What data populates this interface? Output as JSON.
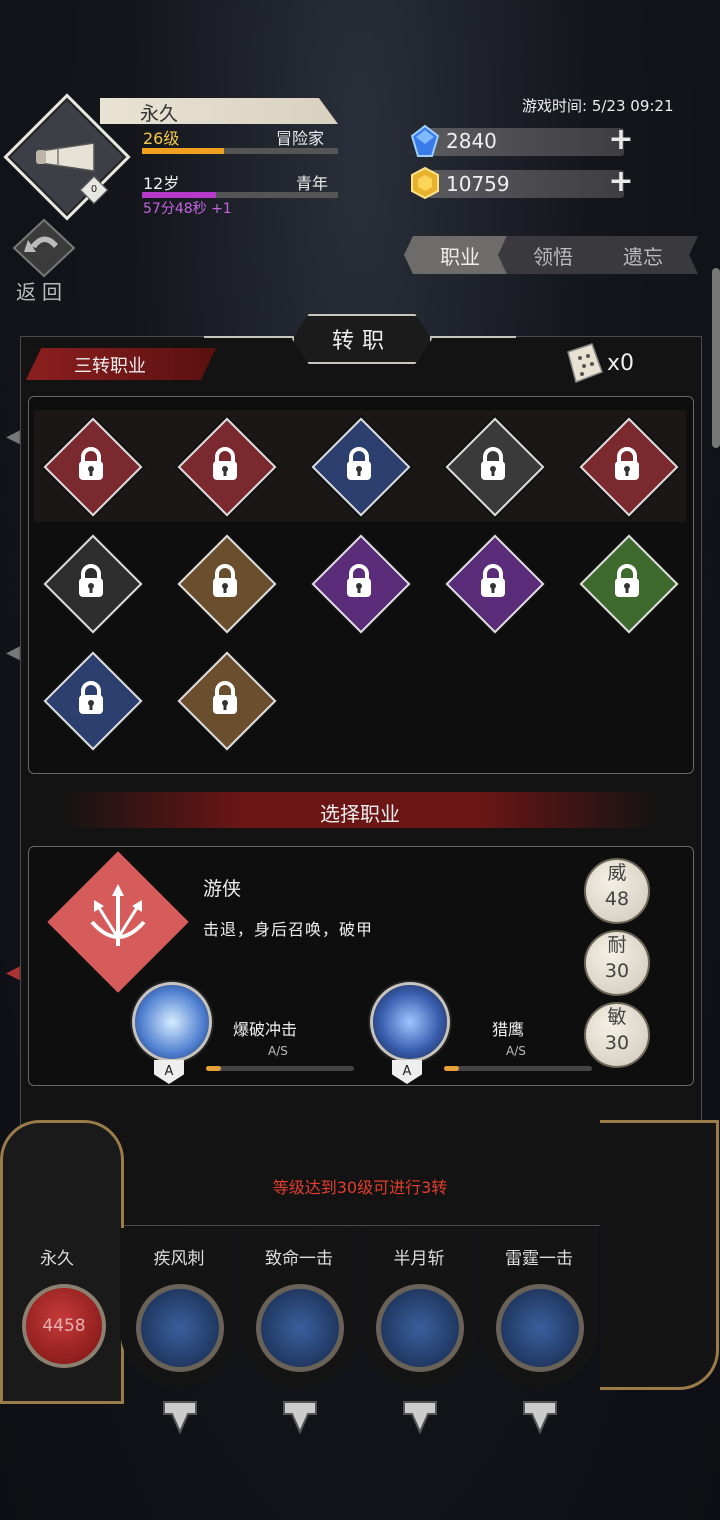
{
  "header": {
    "player_name": "永久",
    "level_text": "26级",
    "job_text": "冒险家",
    "level_progress": 0.42,
    "age_text": "12岁",
    "stage_text": "青年",
    "age_progress": 0.38,
    "timer_text": "57分48秒 +1",
    "avatar_badge": "0",
    "game_time": "游戏时间: 5/23 09:21",
    "gems": "2840",
    "gold": "10759",
    "back_label": "返回"
  },
  "tabs": [
    {
      "label": "职业",
      "active": true
    },
    {
      "label": "领悟",
      "active": false
    },
    {
      "label": "遗忘",
      "active": false
    }
  ],
  "panel": {
    "title": "转职",
    "tier_label": "三转职业",
    "scroll_count": "x0",
    "jobs": [
      {
        "color": "#7a2a2e",
        "icon": "lock-icon"
      },
      {
        "color": "#7a2a2e",
        "icon": "lock-icon"
      },
      {
        "color": "#2c3f6e",
        "icon": "lock-icon"
      },
      {
        "color": "#3a3a3a",
        "icon": "lock-icon"
      },
      {
        "color": "#7a2a2e",
        "icon": "lock-icon"
      },
      {
        "color": "#2e2e2e",
        "icon": "lock-icon"
      },
      {
        "color": "#6b4e2e",
        "icon": "lock-icon"
      },
      {
        "color": "#5b2c7a",
        "icon": "lock-icon"
      },
      {
        "color": "#5b2c7a",
        "icon": "lock-icon"
      },
      {
        "color": "#3e6a2e",
        "icon": "lock-icon"
      },
      {
        "color": "#2c3f6e",
        "icon": "lock-icon"
      },
      {
        "color": "#6b4e2e",
        "icon": "lock-icon"
      }
    ],
    "select_label": "选择职业",
    "class_name": "游侠",
    "class_desc": "击退，身后召唤，破甲",
    "stats": [
      {
        "label": "威",
        "value": "48"
      },
      {
        "label": "耐",
        "value": "30"
      },
      {
        "label": "敏",
        "value": "30"
      }
    ],
    "skills": [
      {
        "name": "爆破冲击",
        "grade": "A",
        "rank": "A/S",
        "progress": 0.1
      },
      {
        "name": "猎鹰",
        "grade": "A",
        "rank": "A/S",
        "progress": 0.1
      }
    ],
    "requirement": "等级达到30级可进行3转"
  },
  "bottom": {
    "hero_name": "永久",
    "hp": "4458",
    "skills": [
      {
        "name": "疾风刺"
      },
      {
        "name": "致命一击"
      },
      {
        "name": "半月斩"
      },
      {
        "name": "雷霆一击"
      }
    ]
  }
}
